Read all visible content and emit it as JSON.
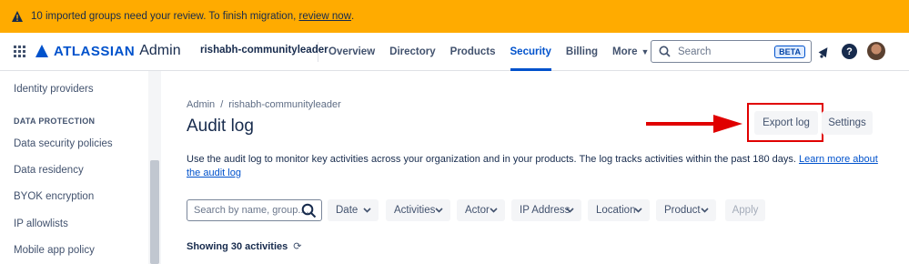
{
  "banner": {
    "message": "10 imported groups need your review. To finish migration,",
    "link": "review now",
    "suffix": "."
  },
  "topnav": {
    "brand": "ATLASSIAN",
    "product": "Admin",
    "org_name": "rishabh-communityleader",
    "items": [
      {
        "label": "Overview"
      },
      {
        "label": "Directory"
      },
      {
        "label": "Products"
      },
      {
        "label": "Security"
      },
      {
        "label": "Billing"
      },
      {
        "label": "More"
      }
    ],
    "active_item": "Security",
    "search_placeholder": "Search",
    "search_badge": "BETA"
  },
  "sidebar": {
    "items_top": [
      {
        "label": "Identity providers"
      }
    ],
    "section_heading": "DATA PROTECTION",
    "items": [
      {
        "label": "Data security policies"
      },
      {
        "label": "Data residency"
      },
      {
        "label": "BYOK encryption"
      },
      {
        "label": "IP allowlists"
      },
      {
        "label": "Mobile app policy"
      }
    ]
  },
  "main": {
    "breadcrumb": [
      "Admin",
      "rishabh-communityleader"
    ],
    "breadcrumb_separator": "/",
    "title": "Audit log",
    "export_label": "Export log",
    "settings_label": "Settings",
    "description": "Use the audit log to monitor key activities across your organization and in your products. The log tracks activities within the past 180 days.",
    "description_link": "Learn more about the audit log",
    "filter_placeholder": "Search by name, group....",
    "filters": [
      {
        "label": "Date"
      },
      {
        "label": "Activities"
      },
      {
        "label": "Actor"
      },
      {
        "label": "IP Address"
      },
      {
        "label": "Location"
      },
      {
        "label": "Product"
      }
    ],
    "apply_label": "Apply",
    "showing_text": "Showing 30 activities"
  },
  "colors": {
    "banner": "#ffab00",
    "brand": "#0052cc",
    "annotation": "#e00000"
  },
  "icons": [
    "warning-icon",
    "app-switcher-icon",
    "atlassian-logo-icon",
    "search-icon",
    "notification-icon",
    "help-icon",
    "avatar",
    "chevron-down-icon",
    "refresh-icon",
    "arrow-annotation"
  ]
}
